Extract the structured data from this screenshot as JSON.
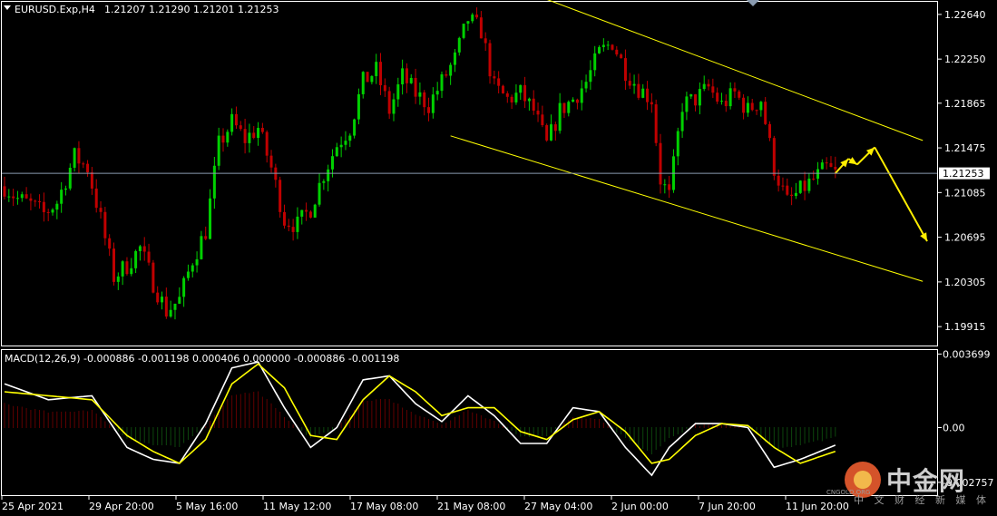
{
  "header": {
    "symbol": "EURUSD.Exp,H4",
    "ohlc": "1.21207 1.21290 1.21201 1.21253"
  },
  "macd_header": "MACD(12,26,9) -0.000886 -0.001198 0.000406 0.000000 -0.000886 -0.001198",
  "current_price_label": "1.21253",
  "watermark": {
    "main": "中金网",
    "sub": "中 文 财 经 新 媒 体",
    "latin": "CNGOLD.ORG"
  },
  "colors": {
    "background": "#000000",
    "bull": "#00d000",
    "bear": "#c00000",
    "channel": "#ffff00",
    "macd_main": "#ffffff",
    "macd_signal": "#ffff00",
    "hist_pos": "#c00000",
    "hist_neg": "#1a8a1a",
    "arrow": "#ffee00"
  },
  "chart_data": [
    {
      "type": "candlestick",
      "title": "EURUSD.Exp,H4",
      "ylim": [
        1.1975,
        1.2275
      ],
      "y_ticks": [
        "1.22640",
        "1.22250",
        "1.21865",
        "1.21475",
        "1.21085",
        "1.20695",
        "1.20305",
        "1.19915"
      ],
      "y_tick_values": [
        1.2264,
        1.2225,
        1.21865,
        1.21475,
        1.21085,
        1.20695,
        1.20305,
        1.19915
      ],
      "x_ticks": [
        "25 Apr 2021",
        "29 Apr 20:00",
        "5 May 16:00",
        "11 May 12:00",
        "17 May 08:00",
        "21 May 08:00",
        "27 May 04:00",
        "2 Jun 00:00",
        "7 Jun 20:00",
        "11 Jun 20:00"
      ],
      "current_price": 1.21253,
      "close_path": [
        [
          0,
          1.2114
        ],
        [
          3,
          1.2103
        ],
        [
          6,
          1.2098
        ],
        [
          9,
          1.209
        ],
        [
          12,
          1.21
        ],
        [
          16,
          1.214
        ],
        [
          19,
          1.213
        ],
        [
          22,
          1.2085
        ],
        [
          25,
          1.2035
        ],
        [
          28,
          1.2045
        ],
        [
          31,
          1.206
        ],
        [
          34,
          1.203
        ],
        [
          37,
          1.2005
        ],
        [
          40,
          1.2015
        ],
        [
          43,
          1.205
        ],
        [
          46,
          1.2075
        ],
        [
          49,
          1.215
        ],
        [
          52,
          1.217
        ],
        [
          55,
          1.2155
        ],
        [
          58,
          1.2165
        ],
        [
          61,
          1.213
        ],
        [
          64,
          1.2085
        ],
        [
          67,
          1.208
        ],
        [
          70,
          1.2095
        ],
        [
          73,
          1.2125
        ],
        [
          76,
          1.215
        ],
        [
          79,
          1.2165
        ],
        [
          82,
          1.2205
        ],
        [
          85,
          1.2215
        ],
        [
          88,
          1.218
        ],
        [
          91,
          1.221
        ],
        [
          94,
          1.2195
        ],
        [
          97,
          1.2185
        ],
        [
          100,
          1.2205
        ],
        [
          103,
          1.2225
        ],
        [
          106,
          1.226
        ],
        [
          109,
          1.225
        ],
        [
          112,
          1.22
        ],
        [
          115,
          1.219
        ],
        [
          118,
          1.2195
        ],
        [
          121,
          1.218
        ],
        [
          124,
          1.215
        ],
        [
          127,
          1.218
        ],
        [
          130,
          1.219
        ],
        [
          133,
          1.2205
        ],
        [
          136,
          1.223
        ],
        [
          139,
          1.224
        ],
        [
          142,
          1.2215
        ],
        [
          145,
          1.22
        ],
        [
          148,
          1.219
        ],
        [
          150,
          1.212
        ],
        [
          152,
          1.2105
        ],
        [
          155,
          1.2185
        ],
        [
          158,
          1.219
        ],
        [
          161,
          1.22
        ],
        [
          164,
          1.2185
        ],
        [
          167,
          1.2195
        ],
        [
          170,
          1.218
        ],
        [
          173,
          1.219
        ],
        [
          176,
          1.213
        ],
        [
          179,
          1.21
        ],
        [
          182,
          1.211
        ],
        [
          185,
          1.212
        ],
        [
          188,
          1.213
        ],
        [
          190,
          1.2125
        ]
      ],
      "channel": {
        "upper": [
          [
            115,
            1.229
          ],
          [
            210,
            1.2154
          ]
        ],
        "lower": [
          [
            102,
            1.2158
          ],
          [
            210,
            1.2031
          ]
        ]
      },
      "projection": [
        [
          190,
          1.21253
        ],
        [
          193,
          1.2138
        ],
        [
          195,
          1.2133
        ],
        [
          199,
          1.2148
        ],
        [
          211,
          1.2066
        ]
      ]
    },
    {
      "type": "macd",
      "title": "MACD(12,26,9) -0.000886 -0.001198 0.000406 0.000000 -0.000886 -0.001198",
      "params": [
        12,
        26,
        9
      ],
      "ylim": [
        -0.0034,
        0.0039
      ],
      "y_ticks": [
        "0.003699",
        "0.00",
        "-0.002757"
      ],
      "y_tick_values": [
        0.003699,
        0.0,
        -0.002757
      ],
      "series": [
        {
          "name": "main",
          "x": [
            0,
            10,
            20,
            28,
            34,
            40,
            46,
            52,
            58,
            64,
            70,
            76,
            82,
            88,
            94,
            100,
            106,
            112,
            118,
            124,
            130,
            136,
            142,
            148,
            152,
            158,
            164,
            170,
            176,
            182,
            190
          ],
          "values": [
            0.0022,
            0.0014,
            0.0016,
            -0.001,
            -0.0016,
            -0.0018,
            0.0002,
            0.003,
            0.0033,
            0.001,
            -0.001,
            0.0,
            0.0024,
            0.0026,
            0.0012,
            0.0003,
            0.0016,
            0.0006,
            -0.0008,
            -0.0008,
            0.001,
            0.0008,
            -0.001,
            -0.0024,
            -0.001,
            0.0002,
            0.0002,
            0.0,
            -0.002,
            -0.0016,
            -0.000886
          ]
        },
        {
          "name": "signal",
          "x": [
            0,
            10,
            20,
            28,
            34,
            40,
            46,
            52,
            58,
            64,
            70,
            76,
            82,
            88,
            94,
            100,
            106,
            112,
            118,
            124,
            130,
            136,
            142,
            148,
            152,
            158,
            164,
            170,
            176,
            182,
            190
          ],
          "values": [
            0.0018,
            0.0016,
            0.0014,
            -0.0004,
            -0.0012,
            -0.0018,
            -0.0006,
            0.0022,
            0.0032,
            0.002,
            -0.0004,
            -0.0006,
            0.0014,
            0.0026,
            0.0018,
            0.0006,
            0.001,
            0.001,
            -0.0002,
            -0.0006,
            0.0004,
            0.0008,
            -0.0002,
            -0.0018,
            -0.0016,
            -0.0004,
            0.0002,
            0.0001,
            -0.001,
            -0.0018,
            -0.001198
          ]
        }
      ]
    }
  ]
}
